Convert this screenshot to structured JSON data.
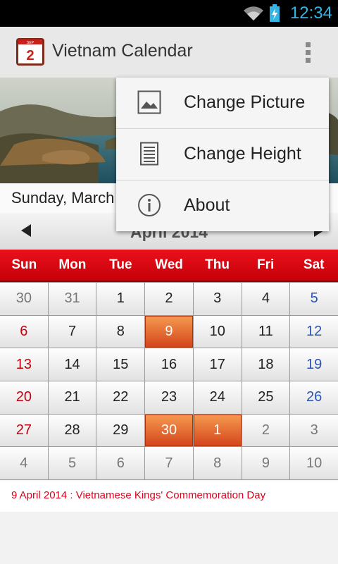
{
  "status_bar": {
    "time": "12:34",
    "icons": [
      "wifi-icon",
      "battery-charging-icon"
    ]
  },
  "action_bar": {
    "app_icon_text": "2",
    "app_icon_month": "SEP",
    "title": "Vietnam Calendar",
    "overflow_icon": "overflow-menu-icon"
  },
  "date_line": "Sunday, March",
  "month_header": {
    "title": "April  2014",
    "prev_icon": "prev-arrow-icon",
    "next_icon": "next-arrow-icon"
  },
  "weekdays": [
    "Sun",
    "Mon",
    "Tue",
    "Wed",
    "Thu",
    "Fri",
    "Sat"
  ],
  "weeks": [
    [
      {
        "d": "30",
        "o": true
      },
      {
        "d": "31",
        "o": true
      },
      {
        "d": "1"
      },
      {
        "d": "2"
      },
      {
        "d": "3"
      },
      {
        "d": "4"
      },
      {
        "d": "5"
      }
    ],
    [
      {
        "d": "6"
      },
      {
        "d": "7"
      },
      {
        "d": "8"
      },
      {
        "d": "9",
        "h": true
      },
      {
        "d": "10"
      },
      {
        "d": "11"
      },
      {
        "d": "12"
      }
    ],
    [
      {
        "d": "13"
      },
      {
        "d": "14"
      },
      {
        "d": "15"
      },
      {
        "d": "16"
      },
      {
        "d": "17"
      },
      {
        "d": "18"
      },
      {
        "d": "19"
      }
    ],
    [
      {
        "d": "20"
      },
      {
        "d": "21"
      },
      {
        "d": "22"
      },
      {
        "d": "23"
      },
      {
        "d": "24"
      },
      {
        "d": "25"
      },
      {
        "d": "26"
      }
    ],
    [
      {
        "d": "27"
      },
      {
        "d": "28"
      },
      {
        "d": "29"
      },
      {
        "d": "30",
        "h": true
      },
      {
        "d": "1",
        "o": true,
        "h": true
      },
      {
        "d": "2",
        "o": true
      },
      {
        "d": "3",
        "o": true
      }
    ],
    [
      {
        "d": "4",
        "o": true
      },
      {
        "d": "5",
        "o": true
      },
      {
        "d": "6",
        "o": true
      },
      {
        "d": "7",
        "o": true
      },
      {
        "d": "8",
        "o": true
      },
      {
        "d": "9",
        "o": true
      },
      {
        "d": "10",
        "o": true
      }
    ]
  ],
  "holiday_note": "9 April 2014 : Vietnamese Kings' Commemoration Day",
  "menu": {
    "items": [
      {
        "label": "Change Picture",
        "icon": "picture-icon"
      },
      {
        "label": "Change Height",
        "icon": "height-icon"
      },
      {
        "label": "About",
        "icon": "info-icon"
      }
    ]
  },
  "colors": {
    "weekday_bar": "#d90a13",
    "holiday_cell": "#e8642f",
    "sunday": "#c7000c",
    "saturday": "#2956b2",
    "accent": "#33b5e5"
  }
}
